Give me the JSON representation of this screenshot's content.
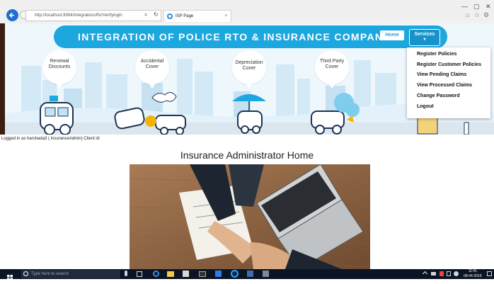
{
  "browser": {
    "address": "http://localhost:8084/IntegrationsRo/Verifylogin",
    "tab_title": "ISP Page",
    "tab_close": "×",
    "minimize": "—",
    "maximize": "▢",
    "close": "✕"
  },
  "nav": {
    "title": "INTEGRATION OF POLICE RTO & INSURANCE COMPANY",
    "home_label": "Home",
    "services_label": "Services",
    "services_arrow": "▾"
  },
  "bubbles": [
    {
      "label": "Renewal Discounts"
    },
    {
      "label": "Accidental Cover"
    },
    {
      "label": "Depreciation Cover"
    },
    {
      "label": "Third Party Cover"
    }
  ],
  "services_menu": [
    "Register Policies",
    "Register Customer Policies",
    "View Pending Claims",
    "View Processed Claims",
    "Change Password",
    "Logout"
  ],
  "status": {
    "logged_in": "Logged in as harshada3 ( insuranceAdmin) Client id:"
  },
  "main": {
    "heading": "Insurance Administrator Home"
  },
  "taskbar": {
    "search_placeholder": "Type here to search",
    "time": "11:41",
    "date": "08-04-2019"
  },
  "colors": {
    "accent": "#1da7df",
    "taskbar": "#0b1424"
  }
}
